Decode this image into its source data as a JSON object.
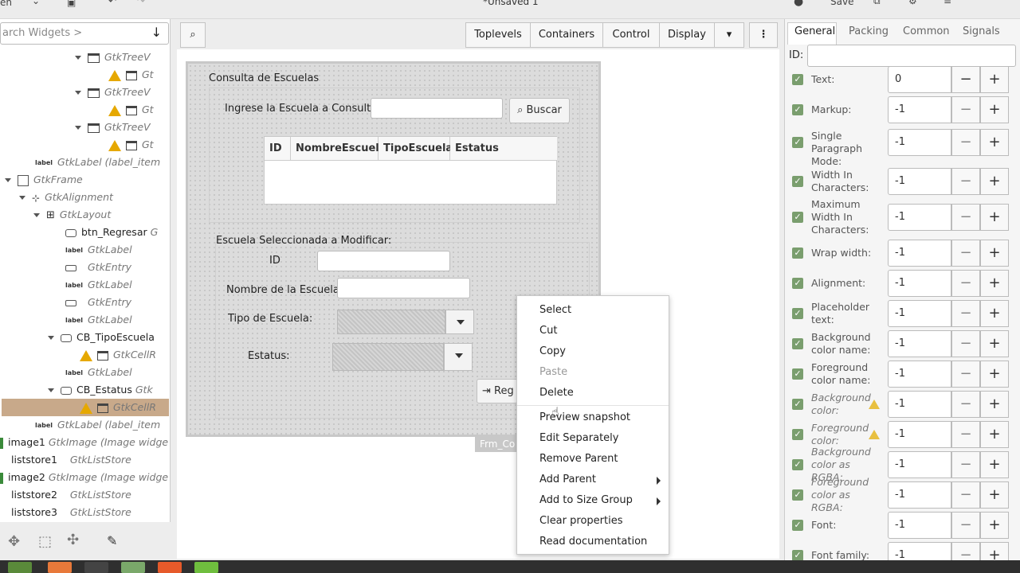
{
  "header": {
    "title": "*Unsaved 1",
    "app_label": "en",
    "save_label": "Save"
  },
  "left": {
    "search_placeholder": "arch Widgets >",
    "rows": [
      {
        "name": "",
        "type": "GtkTreeV"
      },
      {
        "name": "",
        "type": "Gt"
      },
      {
        "name": "",
        "type": "GtkTreeV"
      },
      {
        "name": "",
        "type": "Gt"
      },
      {
        "name": "",
        "type": "GtkTreeV"
      },
      {
        "name": "",
        "type": "Gt"
      },
      {
        "name": "",
        "type": "GtkLabel  (label_item"
      },
      {
        "name": "",
        "type": "GtkFrame"
      },
      {
        "name": "",
        "type": "GtkAlignment"
      },
      {
        "name": "",
        "type": "GtkLayout"
      },
      {
        "name": "btn_Regresar",
        "type": "G"
      },
      {
        "name": "",
        "type": "GtkLabel"
      },
      {
        "name": "",
        "type": "GtkEntry"
      },
      {
        "name": "",
        "type": "GtkLabel"
      },
      {
        "name": "",
        "type": "GtkEntry"
      },
      {
        "name": "",
        "type": "GtkLabel"
      },
      {
        "name": "CB_TipoEscuela",
        "type": ""
      },
      {
        "name": "",
        "type": "GtkCellR"
      },
      {
        "name": "",
        "type": "GtkLabel"
      },
      {
        "name": "CB_Estatus",
        "type": "Gtk"
      },
      {
        "name": "",
        "type": "GtkCellR"
      },
      {
        "name": "",
        "type": "GtkLabel  (label_item"
      },
      {
        "name": "image1",
        "type": "GtkImage  (Image widge"
      },
      {
        "name": "liststore1",
        "type": "GtkListStore"
      },
      {
        "name": "image2",
        "type": "GtkImage  (Image widge"
      },
      {
        "name": "liststore2",
        "type": "GtkListStore"
      },
      {
        "name": "liststore3",
        "type": "GtkListStore"
      }
    ],
    "label_tag": "label"
  },
  "toolbar": {
    "toplevels": "Toplevels",
    "containers": "Containers",
    "control": "Control",
    "display": "Display"
  },
  "form": {
    "frame1_title": "Consulta de Escuelas",
    "prompt": "Ingrese la Escuela a Consultar",
    "search_btn": "Buscar",
    "columns": [
      "ID",
      "NombreEscuela",
      "TipoEscuela",
      "Estatus"
    ],
    "frame2_title": "Escuela Seleccionada a Modificar:",
    "id_label": "ID",
    "name_label": "Nombre de la Escuela:",
    "type_label": "Tipo de Escuela:",
    "status_label": "Estatus:",
    "regresar_btn": "Reg",
    "window_name": "Frm_Co"
  },
  "menu": {
    "items": [
      "Select",
      "Cut",
      "Copy",
      "Paste",
      "Delete",
      "Preview snapshot",
      "Edit Separately",
      "Remove Parent",
      "Add Parent",
      "Add to Size Group",
      "Clear properties",
      "Read documentation"
    ]
  },
  "props": {
    "tabs": [
      "General",
      "Packing",
      "Common",
      "Signals"
    ],
    "id_label": "ID:",
    "rows": [
      {
        "label": "Text:",
        "value": "0"
      },
      {
        "label": "Markup:",
        "value": "-1"
      },
      {
        "label": "Single Paragraph Mode:",
        "value": "-1"
      },
      {
        "label": "Width In Characters:",
        "value": "-1"
      },
      {
        "label": "Maximum Width In Characters:",
        "value": "-1"
      },
      {
        "label": "Wrap width:",
        "value": "-1"
      },
      {
        "label": "Alignment:",
        "value": "-1"
      },
      {
        "label": "Placeholder text:",
        "value": "-1"
      },
      {
        "label": "Background color name:",
        "value": "-1"
      },
      {
        "label": "Foreground color name:",
        "value": "-1"
      },
      {
        "label": "Background color:",
        "value": "-1"
      },
      {
        "label": "Foreground color:",
        "value": "-1"
      },
      {
        "label": "Background color as RGBA:",
        "value": "-1"
      },
      {
        "label": "Foreground color as RGBA:",
        "value": "-1"
      },
      {
        "label": "Font:",
        "value": "-1"
      },
      {
        "label": "Font family:",
        "value": "-1"
      }
    ]
  }
}
